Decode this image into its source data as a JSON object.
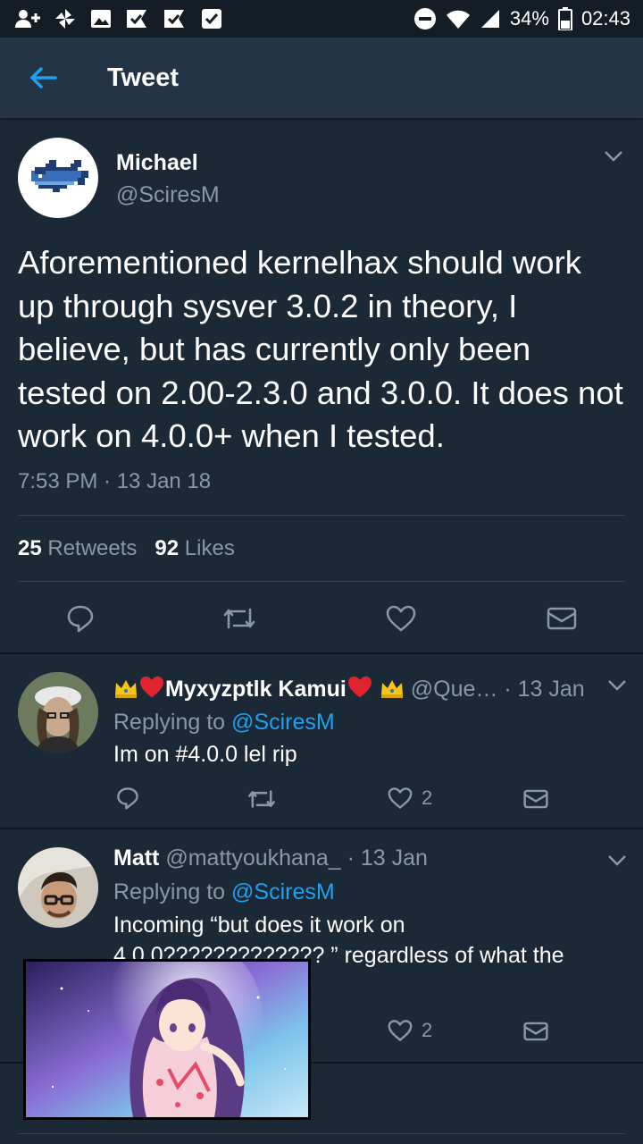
{
  "status_bar": {
    "battery": "34%",
    "time": "02:43"
  },
  "app_bar": {
    "title": "Tweet"
  },
  "main_tweet": {
    "name": "Michael",
    "handle": "@SciresM",
    "text": "Aforementioned kernelhax should work up through sysver 3.0.2 in theory, I believe, but has currently only been tested on 2.00-2.3.0 and 3.0.0. It does not work on 4.0.0+ when I tested.",
    "timestamp": "7:53 PM · 13 Jan 18",
    "retweets_count": "25",
    "retweets_label": "Retweets",
    "likes_count": "92",
    "likes_label": "Likes"
  },
  "replies": [
    {
      "name": "Myxyzptlk Kamui",
      "handle": "@Que…",
      "date": "· 13 Jan",
      "replying_prefix": "Replying to ",
      "replying_to": "@SciresM",
      "text": "Im on #4.0.0 lel rip",
      "likes": "2"
    },
    {
      "name": "Matt",
      "handle": "@mattyoukhana_",
      "date": "· 13 Jan",
      "replying_prefix": "Replying to ",
      "replying_to": "@SciresM",
      "text_line1": "Incoming “but does it work on",
      "text_line2": "4.0.0????????????? ” regardless of what the",
      "likes": "2"
    }
  ],
  "colors": {
    "background": "#1b2836",
    "app_bar": "#243447",
    "accent": "#1da1f2",
    "muted": "#8899a6",
    "like_heart": "#e0245e"
  },
  "icons": {
    "back": "arrow-left-icon",
    "reply": "reply-icon",
    "retweet": "retweet-icon",
    "like": "heart-icon",
    "dm": "envelope-icon",
    "more": "chevron-down-icon"
  }
}
